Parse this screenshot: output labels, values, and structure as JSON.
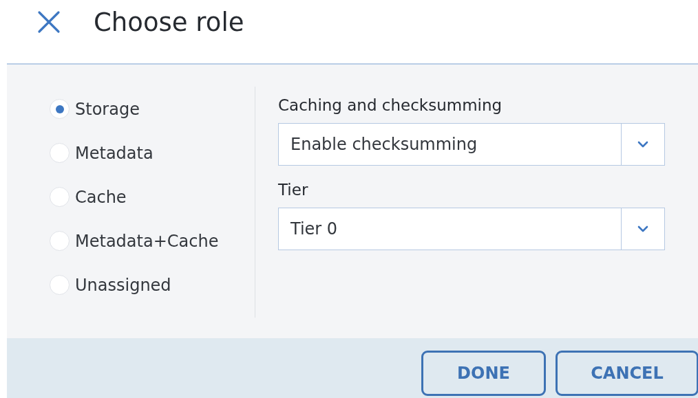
{
  "dialog": {
    "title": "Choose role"
  },
  "roles": [
    {
      "label": "Storage",
      "selected": true
    },
    {
      "label": "Metadata",
      "selected": false
    },
    {
      "label": "Cache",
      "selected": false
    },
    {
      "label": "Metadata+Cache",
      "selected": false
    },
    {
      "label": "Unassigned",
      "selected": false
    }
  ],
  "fields": [
    {
      "label": "Caching and checksumming",
      "value": "Enable checksumming"
    },
    {
      "label": "Tier",
      "value": "Tier 0"
    }
  ],
  "buttons": [
    "DONE",
    "CANCEL"
  ]
}
